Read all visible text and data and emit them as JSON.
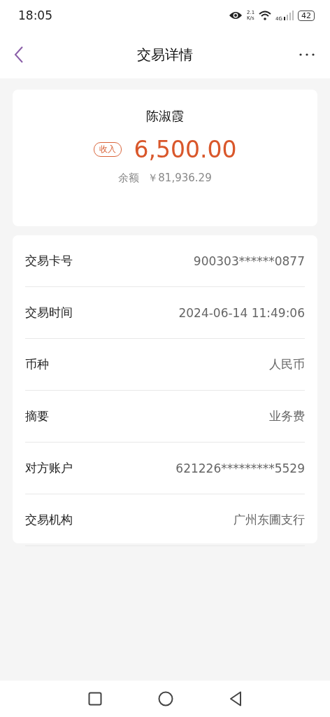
{
  "status_bar": {
    "time": "18:05",
    "net_speed": "2.1",
    "net_unit": "K/s",
    "network": "4G",
    "battery": "42"
  },
  "header": {
    "title": "交易详情"
  },
  "summary": {
    "name": "陈淑霞",
    "tag": "收入",
    "amount": "6,500.00",
    "balance_label": "余额",
    "balance": "￥81,936.29"
  },
  "details": [
    {
      "label": "交易卡号",
      "value": "900303******0877"
    },
    {
      "label": "交易时间",
      "value": "2024-06-14 11:49:06"
    },
    {
      "label": "币种",
      "value": "人民币"
    },
    {
      "label": "摘要",
      "value": "业务费"
    },
    {
      "label": "对方账户",
      "value": "621226*********5529"
    },
    {
      "label": "交易机构",
      "value": "广州东圃支行"
    }
  ]
}
